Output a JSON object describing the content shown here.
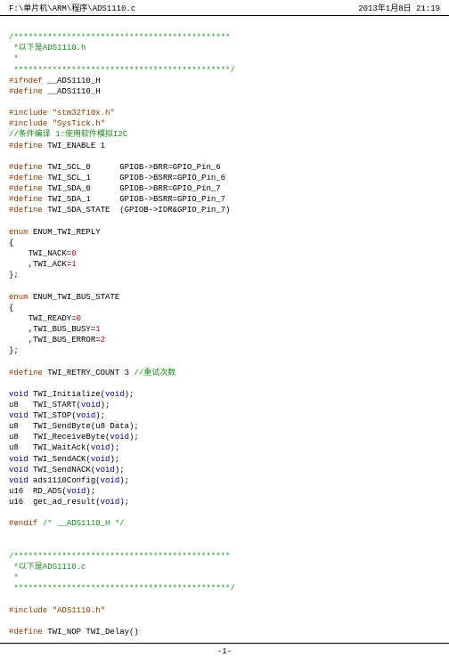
{
  "header": {
    "path": "F:\\单片机\\ARM\\程序\\ADS1110.c",
    "timestamp": "2013年1月8日 21:19"
  },
  "footer": {
    "page": "-1-"
  },
  "code": {
    "l1": "/*********************************************",
    "l2": " *以下是ADS1110.h",
    "l3": " *",
    "l4": " *********************************************/",
    "l5a": "#ifndef",
    "l5b": " __ADS1110_H",
    "l6a": "#define",
    "l6b": " __ADS1110_H",
    "l7a": "#include",
    "l7b": "\"stm32f10x.h\"",
    "l8a": "#include",
    "l8b": "\"SysTick.h\"",
    "l9": "//条件编译 1:使用软件模拟I2C",
    "l10a": "#define",
    "l10b": " TWI_ENABLE 1",
    "l11a": "#define",
    "l11b": " TWI_SCL_0      GPIOB->BRR=GPIO_Pin_6",
    "l12a": "#define",
    "l12b": " TWI_SCL_1      GPIOB->BSRR=GPIO_Pin_6",
    "l13a": "#define",
    "l13b": " TWI_SDA_0      GPIOB->BRR=GPIO_Pin_7",
    "l14a": "#define",
    "l14b": " TWI_SDA_1      GPIOB->BSRR=GPIO_Pin_7",
    "l15a": "#define",
    "l15b": " TWI_SDA_STATE  (GPIOB->IDR&GPIO_Pin_7)",
    "l16a": "enum",
    "l16b": " ENUM_TWI_REPLY",
    "l17": "{",
    "l18a": "    TWI_NACK=",
    "l18b": "0",
    "l19a": "    ,TWI_ACK=",
    "l19b": "1",
    "l20": "};",
    "l21a": "enum",
    "l21b": " ENUM_TWI_BUS_STATE",
    "l22": "{",
    "l23a": "    TWI_READY=",
    "l23b": "0",
    "l24a": "    ,TWI_BUS_BUSY=",
    "l24b": "1",
    "l25a": "    ,TWI_BUS_ERROR=",
    "l25b": "2",
    "l26": "};",
    "l27a": "#define",
    "l27b": " TWI_RETRY_COUNT 3 ",
    "l27c": "//重试次数",
    "f1a": "void",
    "f1b": " TWI_Initialize(",
    "f1c": "void",
    "f1d": ");",
    "f2a": "u8   TWI_START(",
    "f2b": "void",
    "f2c": ");",
    "f3a": "void",
    "f3b": " TWI_STOP(",
    "f3c": "void",
    "f3d": ");",
    "f4a": "u8   TWI_SendByte(u8 Data);",
    "f5a": "u8   TWI_ReceiveByte(",
    "f5b": "void",
    "f5c": ");",
    "f6a": "u8   TWI_WaitAck(",
    "f6b": "void",
    "f6c": ");",
    "f7a": "void",
    "f7b": " TWI_SendACK(",
    "f7c": "void",
    "f7d": ");",
    "f8a": "void",
    "f8b": " TWI_SendNACK(",
    "f8c": "void",
    "f8d": ");",
    "f9a": "void",
    "f9b": " ads1110Config(",
    "f9c": "void",
    "f9d": ");",
    "f10a": "u16  RD_ADS(",
    "f10b": "void",
    "f10c": ");",
    "f11a": "u16  get_ad_result(",
    "f11b": "void",
    "f11c": ");",
    "l30a": "#endif",
    "l30b": "/* __ADS1110_H */",
    "l31": "/*********************************************",
    "l32": " *以下是ADS1110.c",
    "l33": " *",
    "l34": " *********************************************/",
    "l35a": "#include",
    "l35b": "\"ADS1110.h\"",
    "l36a": "#define",
    "l36b": " TWI_NOP TWI_Delay()"
  }
}
